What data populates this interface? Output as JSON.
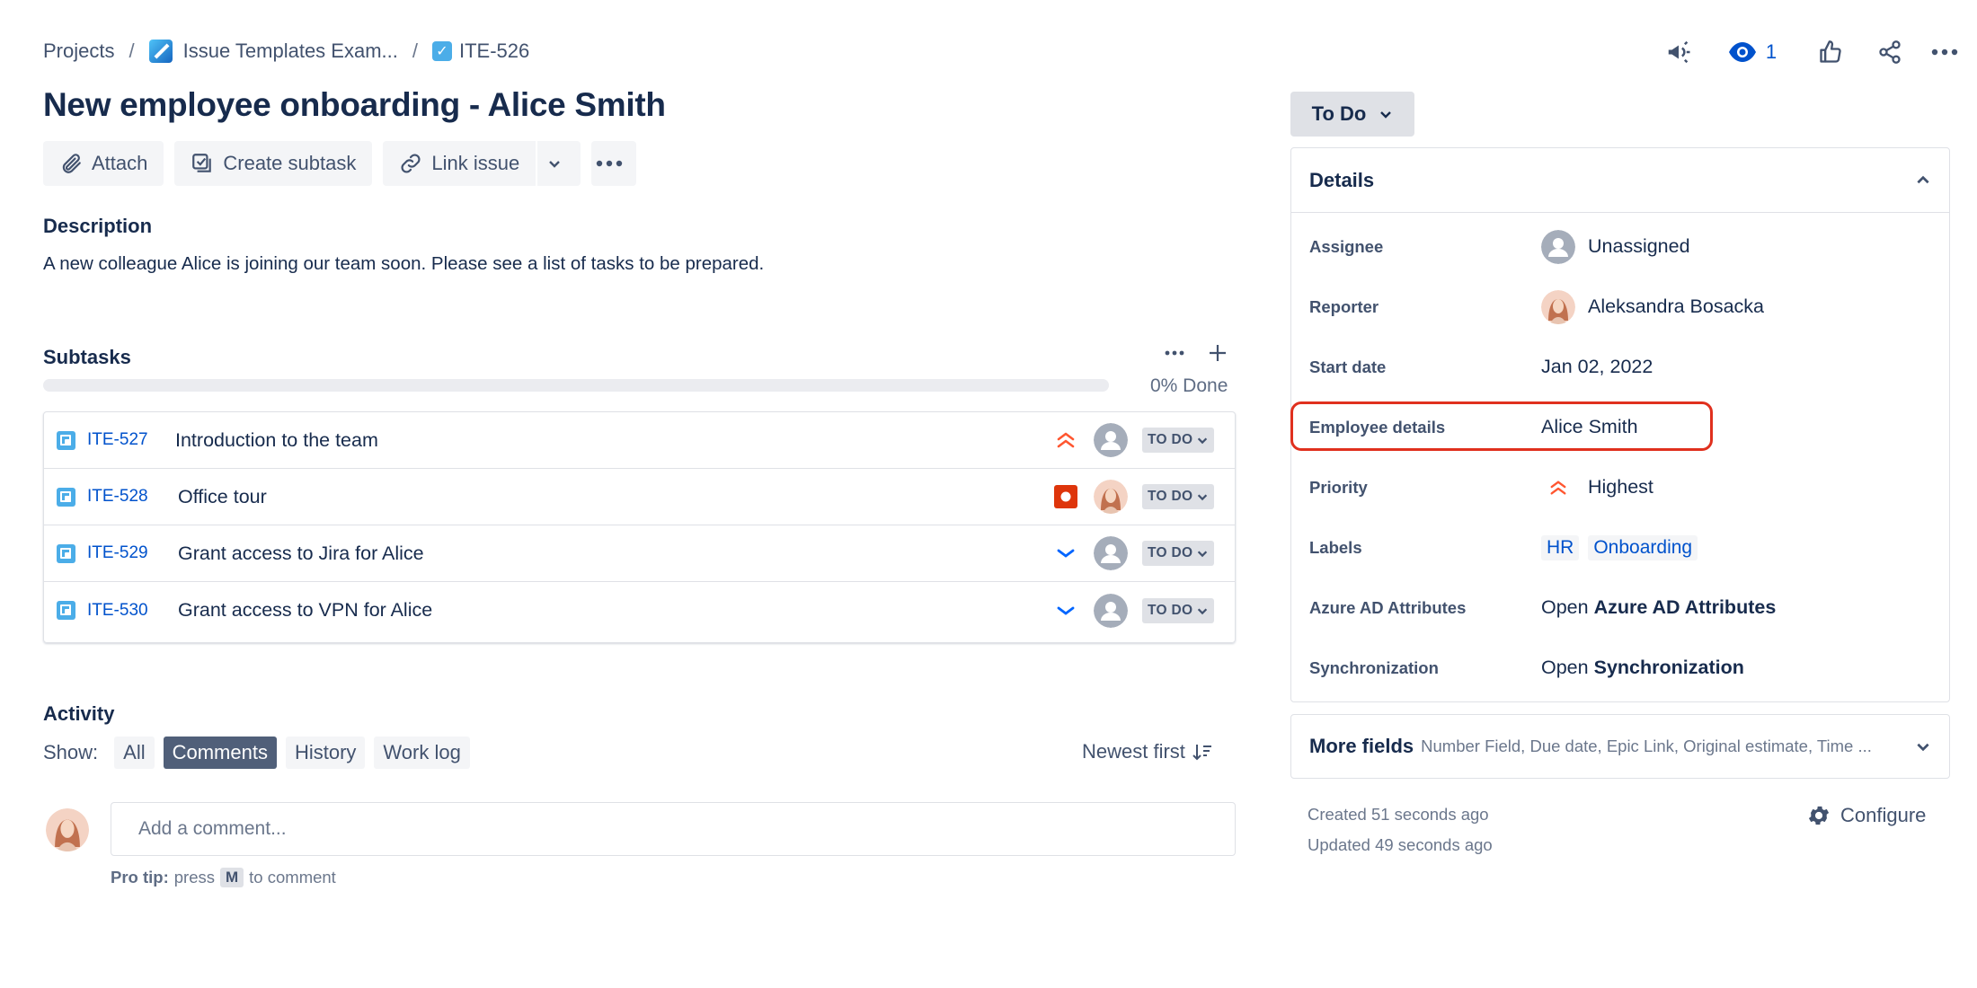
{
  "breadcrumb": {
    "projects": "Projects",
    "separator": "/",
    "project_name": "Issue Templates Exam...",
    "issue_key": "ITE-526"
  },
  "issue": {
    "title": "New employee onboarding - Alice Smith"
  },
  "toolbar": {
    "attach": "Attach",
    "create_subtask": "Create subtask",
    "link_issue": "Link issue"
  },
  "description": {
    "heading": "Description",
    "text": "A new colleague Alice is joining our team soon. Please see a list of tasks to be prepared."
  },
  "subtasks": {
    "heading": "Subtasks",
    "progress_percent": 0,
    "done_label": "0% Done",
    "items": [
      {
        "key": "ITE-527",
        "summary": "Introduction to the team",
        "priority": "Highest",
        "assignee": "Unassigned",
        "status": "TO DO"
      },
      {
        "key": "ITE-528",
        "summary": "Office tour",
        "priority": "Blocker",
        "assignee": "Aleksandra Bosacka",
        "status": "TO DO"
      },
      {
        "key": "ITE-529",
        "summary": "Grant access to Jira for Alice",
        "priority": "Low",
        "assignee": "Unassigned",
        "status": "TO DO"
      },
      {
        "key": "ITE-530",
        "summary": "Grant access to VPN for Alice",
        "priority": "Low",
        "assignee": "Unassigned",
        "status": "TO DO"
      }
    ]
  },
  "activity": {
    "heading": "Activity",
    "show_label": "Show:",
    "filters": [
      "All",
      "Comments",
      "History",
      "Work log"
    ],
    "active_filter": "Comments",
    "sort_label": "Newest first",
    "comment_placeholder": "Add a comment...",
    "protip_bold": "Pro tip:",
    "protip_pre": "press",
    "protip_key": "M",
    "protip_post": "to comment"
  },
  "header_actions": {
    "watchers_count": "1"
  },
  "status_button": "To Do",
  "details": {
    "heading": "Details",
    "assignee_label": "Assignee",
    "assignee_value": "Unassigned",
    "reporter_label": "Reporter",
    "reporter_value": "Aleksandra Bosacka",
    "start_date_label": "Start date",
    "start_date_value": "Jan 02, 2022",
    "employee_label": "Employee details",
    "employee_value": "Alice Smith",
    "priority_label": "Priority",
    "priority_value": "Highest",
    "labels_label": "Labels",
    "labels": [
      "HR",
      "Onboarding"
    ],
    "azure_label": "Azure AD Attributes",
    "azure_open": "Open",
    "azure_link": "Azure AD Attributes",
    "sync_label": "Synchronization",
    "sync_open": "Open",
    "sync_link": "Synchronization"
  },
  "more_fields": {
    "title": "More fields",
    "subtitle": "Number Field, Due date, Epic Link, Original estimate, Time ..."
  },
  "meta": {
    "created": "Created 51 seconds ago",
    "updated": "Updated 49 seconds ago",
    "configure": "Configure"
  },
  "colors": {
    "highlight": "#E0301E",
    "link": "#0052CC",
    "priority_highest": "#FF5630",
    "priority_low": "#0065FF"
  }
}
